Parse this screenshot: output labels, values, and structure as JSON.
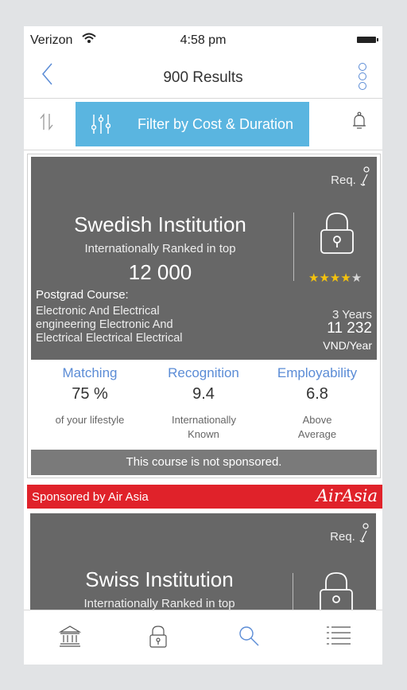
{
  "status_bar": {
    "carrier": "Verizon",
    "time": "4:58 pm"
  },
  "nav": {
    "title": "900 Results"
  },
  "toolbar": {
    "filter_label": "Filter by Cost & Duration"
  },
  "results": [
    {
      "req_label": "Req.",
      "institution": "Swedish Institution",
      "rank_text": "Internationally Ranked in top",
      "rank_value": "12 000",
      "rating_stars": 4,
      "rating_max": 5,
      "course_type": "Postgrad Course:",
      "course_name": "Electronic And Electrical engineering Electronic And Electrical Electrical Electrical",
      "duration": "3 Years",
      "cost": "11 232",
      "cost_unit": "VND/Year",
      "stats": [
        {
          "label": "Matching",
          "value": "75 %",
          "desc": "of your lifestyle"
        },
        {
          "label": "Recognition",
          "value": "9.4",
          "desc": "Internationally Known"
        },
        {
          "label": "Employability",
          "value": "6.8",
          "desc": "Above Average"
        }
      ],
      "sponsor_status": "This course is not sponsored."
    },
    {
      "sponsor_prefix": "Sponsored by",
      "sponsor_name": "Air Asia",
      "sponsor_logo": "AirAsia",
      "req_label": "Req.",
      "institution": "Swiss Institution",
      "rank_text": "Internationally Ranked in top"
    }
  ],
  "colors": {
    "accent": "#5b8cd6",
    "filter_bg": "#5ab5e0",
    "card_bg": "#676767",
    "sponsor_red": "#e0222a",
    "star": "#f4c20d"
  },
  "tabs": [
    {
      "icon": "institution-icon"
    },
    {
      "icon": "lock-icon"
    },
    {
      "icon": "search-icon"
    },
    {
      "icon": "list-icon"
    }
  ]
}
